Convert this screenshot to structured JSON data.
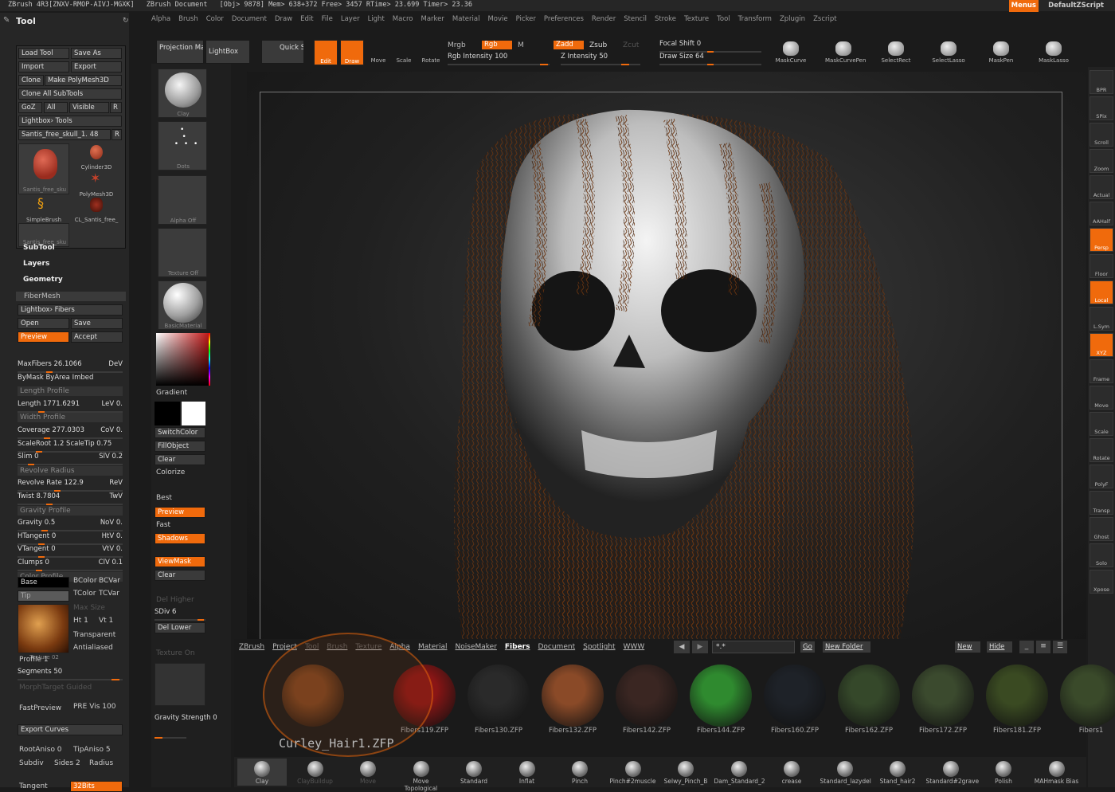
{
  "titlebar": {
    "app": "ZBrush 4R3[ZNXV-RMOP-AIVJ-MGXK]",
    "doc": "ZBrush Document",
    "stats": "[Obj> 9878] Mem> 638+372 Free> 3457 RTime> 23.699 Timer> 23.36",
    "menus_label": "Menus",
    "script_label": "DefaultZScript"
  },
  "menubar": [
    "Alpha",
    "Brush",
    "Color",
    "Document",
    "Draw",
    "Edit",
    "File",
    "Layer",
    "Light",
    "Macro",
    "Marker",
    "Material",
    "Movie",
    "Picker",
    "Preferences",
    "Render",
    "Stencil",
    "Stroke",
    "Texture",
    "Tool",
    "Transform",
    "Zplugin",
    "Zscript"
  ],
  "tool": {
    "title": "Tool",
    "load": "Load Tool",
    "save_as": "Save As",
    "import": "Import",
    "export": "Export",
    "clone": "Clone",
    "make_polymesh": "Make PolyMesh3D",
    "clone_all": "Clone All SubTools",
    "goz": "GoZ",
    "all": "All",
    "visible": "Visible",
    "r": "R",
    "lightbox_tools": "Lightbox› Tools",
    "current_tool": "Santis_free_skull_1. 48",
    "thumbs": [
      "Santis_free_sku",
      "Cylinder3D",
      "PolyMesh3D",
      "SimpleBrush",
      "CL_Santis_free_",
      "Santis_free_sku"
    ],
    "sections": [
      "SubTool",
      "Layers",
      "Geometry"
    ]
  },
  "fibermesh": {
    "header": "FiberMesh",
    "lightbox_fibers": "Lightbox› Fibers",
    "open": "Open",
    "save": "Save",
    "preview": "Preview",
    "accept": "Accept",
    "sliders": [
      {
        "label": "MaxFibers 26.1066",
        "fill": 0.55,
        "right": "DeV"
      },
      {
        "label": "ByMask  ByArea  Imbed",
        "fill": 0,
        "right": ""
      },
      {
        "label": "Length Profile",
        "fill": 0,
        "right": "",
        "header": true
      },
      {
        "label": "Length 1771.6291",
        "fill": 0.4,
        "right": "LeV 0."
      },
      {
        "label": "Width Profile",
        "fill": 0,
        "right": "",
        "header": true
      },
      {
        "label": "Coverage 277.0303",
        "fill": 0.5,
        "right": "CoV 0."
      },
      {
        "label": "ScaleRoot 1.2 ScaleTip 0.75",
        "fill": 0.35,
        "right": ""
      },
      {
        "label": "Slim 0",
        "fill": 0.2,
        "right": "SlV 0.2"
      },
      {
        "label": "Revolve Radius",
        "fill": 0,
        "right": "",
        "header": true
      },
      {
        "label": "Revolve Rate 122.9",
        "fill": 0.7,
        "right": "ReV"
      },
      {
        "label": "Twist 8.7804",
        "fill": 0.55,
        "right": "TwV"
      },
      {
        "label": "Gravity Profile",
        "fill": 0,
        "right": "",
        "header": true
      },
      {
        "label": "Gravity 0.5",
        "fill": 0.45,
        "right": "NoV 0."
      },
      {
        "label": "HTangent 0",
        "fill": 0.4,
        "right": "HtV 0."
      },
      {
        "label": "VTangent 0",
        "fill": 0.4,
        "right": "VtV 0."
      },
      {
        "label": "Clumps 0",
        "fill": 0.35,
        "right": "ClV 0.1"
      },
      {
        "label": "Color Profile",
        "fill": 0,
        "right": "",
        "header": true
      }
    ],
    "base_label": "Base",
    "tip_label": "Tip",
    "bcolor": "BColor",
    "bcvar": "BCVar",
    "tcolor": "TColor",
    "tcvar": "TCVar",
    "max_size": "Max Size",
    "ht": "Ht 1",
    "vt": "Vt 1",
    "texture_label": "Texture 02",
    "transparent": "Transparent",
    "antialiased": "Antialiased",
    "profile": "Profile 1",
    "segments": "Segments 50",
    "morph_target": "MorphTarget Guided",
    "fastpreview": "FastPreview",
    "pre_vis": "PRE Vis 100",
    "export_curves": "Export Curves",
    "root_aniso": "RootAniso 0",
    "tip_aniso": "TipAniso 5",
    "subdiv": "Subdiv",
    "sides": "Sides 2",
    "radius": "Radius",
    "tangent": "Tangent",
    "bits": "32Bits"
  },
  "toolbar": {
    "projection_master": "Projection Master",
    "lightbox": "LightBox",
    "quick_sketch": "Quick Sketch",
    "edit": "Edit",
    "draw": "Draw",
    "move": "Move",
    "scale": "Scale",
    "rotate": "Rotate",
    "mrgb": "Mrgb",
    "rgb": "Rgb",
    "m": "M",
    "rgb_intensity": "Rgb Intensity 100",
    "zadd": "Zadd",
    "zsub": "Zsub",
    "zcut": "Zcut",
    "z_intensity": "Z Intensity 50",
    "focal_shift": "Focal Shift 0",
    "draw_size": "Draw Size 64",
    "tools": [
      "MaskCurve",
      "MaskCurvePen",
      "SelectRect",
      "SelectLasso",
      "MaskPen",
      "MaskLasso"
    ]
  },
  "colorcol": {
    "labels": [
      "Clay",
      "Dots",
      "Alpha Off",
      "Texture Off",
      "BasicMaterial"
    ],
    "gradient": "Gradient",
    "switchcolor": "SwitchColor",
    "fillobject": "FillObject",
    "clear": "Clear",
    "colorize": "Colorize",
    "best": "Best",
    "preview": "Preview",
    "fast": "Fast",
    "shadows": "Shadows",
    "viewmask": "ViewMask",
    "clear2": "Clear",
    "del_higher": "Del Higher",
    "sdiv": "SDiv 6",
    "del_lower": "Del Lower",
    "texture_on": "Texture On",
    "gravity_strength": "Gravity Strength 0"
  },
  "rightbar": [
    "BPR",
    "SPix",
    "Scroll",
    "Zoom",
    "Actual",
    "AAHalf",
    "Persp",
    "Floor",
    "Local",
    "L.Sym",
    "XYZ",
    "Frame",
    "Move",
    "Scale",
    "Rotate",
    "PolyF",
    "Transp",
    "Ghost",
    "Solo",
    "Xpose"
  ],
  "lightbox": {
    "tabs": [
      "ZBrush",
      "Project",
      "Tool",
      "Brush",
      "Texture",
      "Alpha",
      "Material",
      "NoiseMaker",
      "Fibers",
      "Document",
      "Spotlight",
      "WWW"
    ],
    "search": "*.*",
    "go": "Go",
    "new_folder": "New Folder",
    "new": "New",
    "hide": "Hide",
    "items": [
      {
        "name": "Curley_Hair1.ZFP",
        "color": "#7a4320"
      },
      {
        "name": "Fibers119.ZFP",
        "color": "#8a1515"
      },
      {
        "name": "Fibers130.ZFP",
        "color": "#2a2a2a"
      },
      {
        "name": "Fibers132.ZFP",
        "color": "#8a4a28"
      },
      {
        "name": "Fibers142.ZFP",
        "color": "#3a2622"
      },
      {
        "name": "Fibers144.ZFP",
        "color": "#2f8a2f"
      },
      {
        "name": "Fibers160.ZFP",
        "color": "#1e2228"
      },
      {
        "name": "Fibers162.ZFP",
        "color": "#35482a"
      },
      {
        "name": "Fibers172.ZFP",
        "color": "#3b4a2e"
      },
      {
        "name": "Fibers181.ZFP",
        "color": "#3a4a22"
      },
      {
        "name": "Fibers1",
        "color": "#3a4a2a"
      }
    ],
    "hover_name": "Curley_Hair1.ZFP"
  },
  "brushes": [
    "Clay",
    "ClayBuildup",
    "Move",
    "Move Topological",
    "Standard",
    "Inflat",
    "Pinch",
    "Pinch#2muscle",
    "Selwy_Pinch_B",
    "Dam_Standard_2",
    "crease",
    "Standard_lazydel",
    "Stand_hair2",
    "Standard#2grave",
    "Polish",
    "MAHmask Bias"
  ],
  "colors": {
    "accent": "#f06a0c",
    "panel": "#262626",
    "hair": "#5a2e12"
  }
}
